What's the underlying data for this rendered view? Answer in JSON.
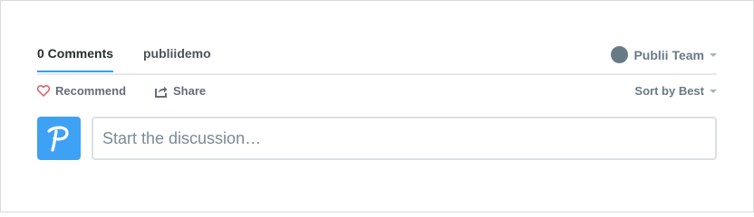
{
  "header": {
    "comments_tab": "0 Comments",
    "site_tab": "publiidemo",
    "user_name": "Publii Team"
  },
  "actions": {
    "recommend_label": "Recommend",
    "share_label": "Share",
    "sort_label": "Sort by Best"
  },
  "composer": {
    "placeholder": "Start the discussion…"
  },
  "colors": {
    "accent": "#2e9fff",
    "brand_avatar": "#3fa1f4",
    "heart": "#e0595e"
  },
  "icons": {
    "recommend": "heart-outline-icon",
    "share": "share-icon",
    "user": "user-avatar-icon",
    "logo": "publii-p-logo-icon"
  }
}
